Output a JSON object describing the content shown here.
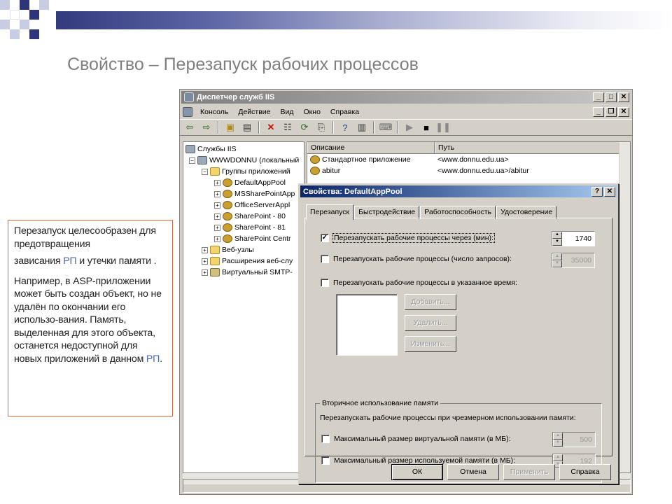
{
  "slide": {
    "title": "Свойство – Перезапуск рабочих процессов",
    "note": {
      "p1_a": "Перезапуск целесообразен для предотвращения",
      "p2_a": "зависания ",
      "p2_accent": "РП",
      "p2_b": " и утечки памяти .",
      "p3_a": "Например, в ASP-приложении может быть создан объект, но не удалён по окончании его использо-вания. Память, выделенная для этого объекта, останется недоступной для новых приложений в данном ",
      "p3_accent": "РП",
      "p3_b": "."
    },
    "colors": {
      "accent": "#4a69b5",
      "border": "#e0643c",
      "title": "#7f7f7f"
    }
  },
  "iis": {
    "title": "Диспетчер служб IIS",
    "menu": [
      "Консоль",
      "Действие",
      "Вид",
      "Окно",
      "Справка"
    ],
    "tree": {
      "root": "Службы IIS",
      "server": "WWWDONNU (локальный",
      "app_pools": "Группы приложений",
      "pools": [
        "DefaultAppPool",
        "MSSharePointApp",
        "OfficeServerAppl",
        "SharePoint - 80",
        "SharePoint - 81",
        "SharePoint Centr"
      ],
      "web_sites": "Веб-узлы",
      "extensions": "Расширения веб-слу",
      "smtp": "Виртуальный SMTP-"
    },
    "list": {
      "columns": [
        "Описание",
        "Путь"
      ],
      "rows": [
        {
          "name": "Стандартное приложение",
          "path": "<www.donnu.edu.ua>"
        },
        {
          "name": "abitur",
          "path": "<www.donnu.edu.ua>/abitur"
        }
      ]
    }
  },
  "dialog": {
    "title": "Свойства: DefaultAppPool",
    "tabs": [
      "Перезапуск",
      "Быстродействие",
      "Работоспособность",
      "Удостоверение"
    ],
    "recycle_minutes_label": "Перезапускать рабочие процессы через (мин):",
    "recycle_minutes_value": "1740",
    "recycle_requests_label": "Перезапускать рабочие процессы (число запросов):",
    "recycle_requests_value": "35000",
    "recycle_time_label": "Перезапускать рабочие процессы в указанное время:",
    "add_btn": "Добавить...",
    "remove_btn": "Удалить...",
    "edit_btn": "Изменить...",
    "memory_group": "Вторичное использование памяти",
    "memory_desc": "Перезапускать рабочие процессы при чрезмерном использовании памяти:",
    "virt_mem_label": "Максимальный размер виртуальной памяти (в МБ):",
    "virt_mem_value": "500",
    "used_mem_label": "Максимальный размер используемой памяти (в МБ):",
    "used_mem_value": "192",
    "ok": "ОК",
    "cancel": "Отмена",
    "apply": "Применить",
    "help": "Справка"
  }
}
